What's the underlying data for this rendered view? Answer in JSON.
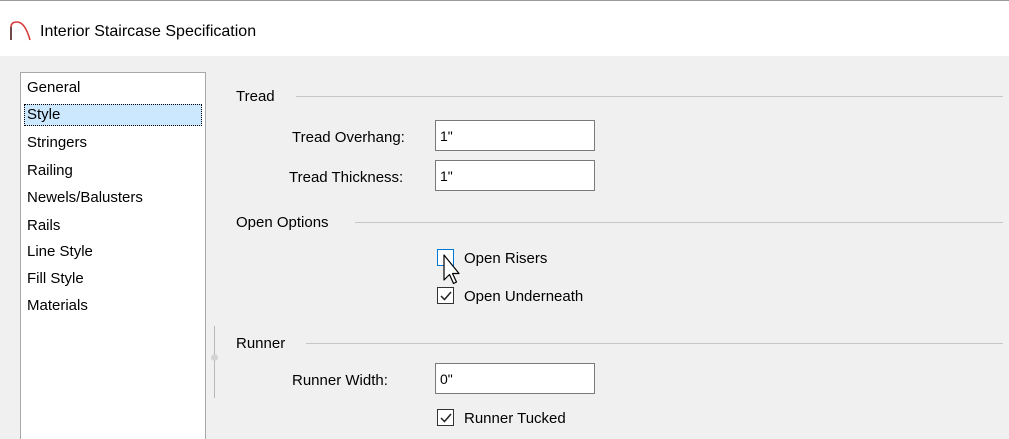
{
  "window": {
    "title": "Interior Staircase Specification",
    "icon": "staircase-arch-icon",
    "accent_color": "#d63a3a"
  },
  "sidebar": {
    "selected_index": 1,
    "items": [
      {
        "label": "General"
      },
      {
        "label": "Style"
      },
      {
        "label": "Stringers"
      },
      {
        "label": "Railing"
      },
      {
        "label": "Newels/Balusters"
      },
      {
        "label": "Rails"
      },
      {
        "label": "Line Style"
      },
      {
        "label": "Fill Style"
      },
      {
        "label": "Materials"
      }
    ]
  },
  "tread": {
    "group_label": "Tread",
    "overhang_label": "Tread Overhang:",
    "overhang_value": "1\"",
    "thickness_label": "Tread Thickness:",
    "thickness_value": "1\""
  },
  "open_options": {
    "group_label": "Open Options",
    "open_risers_label": "Open Risers",
    "open_risers_checked": false,
    "open_underneath_label": "Open Underneath",
    "open_underneath_checked": true
  },
  "runner": {
    "group_label": "Runner",
    "width_label": "Runner Width:",
    "width_value": "0\"",
    "tucked_label": "Runner Tucked",
    "tucked_checked": true
  }
}
